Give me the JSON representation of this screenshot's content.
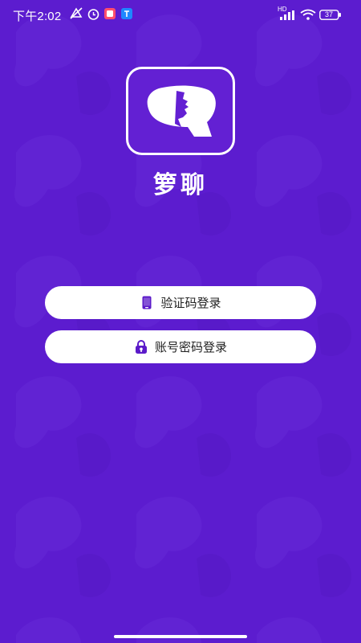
{
  "status_bar": {
    "time": "下午2:02",
    "network_label": "HD",
    "battery": "37"
  },
  "app": {
    "name": "箩聊"
  },
  "login": {
    "sms_label": "验证码登录",
    "password_label": "账号密码登录"
  },
  "colors": {
    "background": "#5c1ccf",
    "accent": "#5b1ac9",
    "button": "#ffffff"
  },
  "icons": {
    "sms": "phone-icon",
    "password": "lock-icon"
  }
}
